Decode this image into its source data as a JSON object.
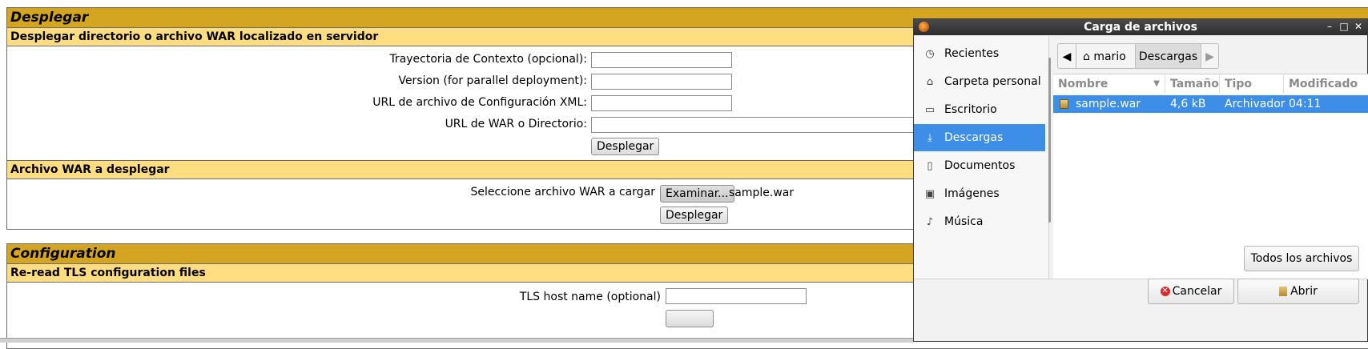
{
  "deploy": {
    "title": "Desplegar",
    "server_section": {
      "title": "Desplegar directorio o archivo WAR localizado en servidor",
      "context_label": "Trayectoria de Contexto (opcional):",
      "context_value": "",
      "version_label": "Version (for parallel deployment):",
      "version_value": "",
      "config_label": "URL de archivo de Configuración XML:",
      "config_value": "",
      "war_label": "URL de WAR o Directorio:",
      "war_value": "",
      "deploy_button": "Desplegar"
    },
    "upload_section": {
      "title": "Archivo WAR a desplegar",
      "select_label": "Seleccione archivo WAR a cargar",
      "browse_button": "Examinar...",
      "selected_file": "sample.war",
      "deploy_button": "Desplegar"
    }
  },
  "configuration": {
    "title": "Configuration",
    "tls_section": {
      "title": "Re-read TLS configuration files",
      "host_label": "TLS host name (optional)",
      "host_value": ""
    }
  },
  "dialog": {
    "title": "Carga de archivos",
    "places": [
      {
        "label": "Recientes",
        "icon": "clock-icon"
      },
      {
        "label": "Carpeta personal",
        "icon": "home-icon"
      },
      {
        "label": "Escritorio",
        "icon": "folder-icon"
      },
      {
        "label": "Descargas",
        "icon": "download-icon",
        "selected": true
      },
      {
        "label": "Documentos",
        "icon": "document-icon"
      },
      {
        "label": "Imágenes",
        "icon": "image-icon"
      },
      {
        "label": "Música",
        "icon": "music-icon"
      }
    ],
    "breadcrumbs": [
      "mario",
      "Descargas"
    ],
    "columns": {
      "name": "Nombre",
      "size": "Tamaño",
      "type": "Tipo",
      "modified": "Modificado"
    },
    "files": [
      {
        "name": "sample.war",
        "size": "4,6 kB",
        "type": "Archivador",
        "modified": "04:11"
      }
    ],
    "filter": "Todos los archivos",
    "cancel_button": "Cancelar",
    "open_button": "Abrir",
    "accent_color": "#3d8ee6"
  }
}
